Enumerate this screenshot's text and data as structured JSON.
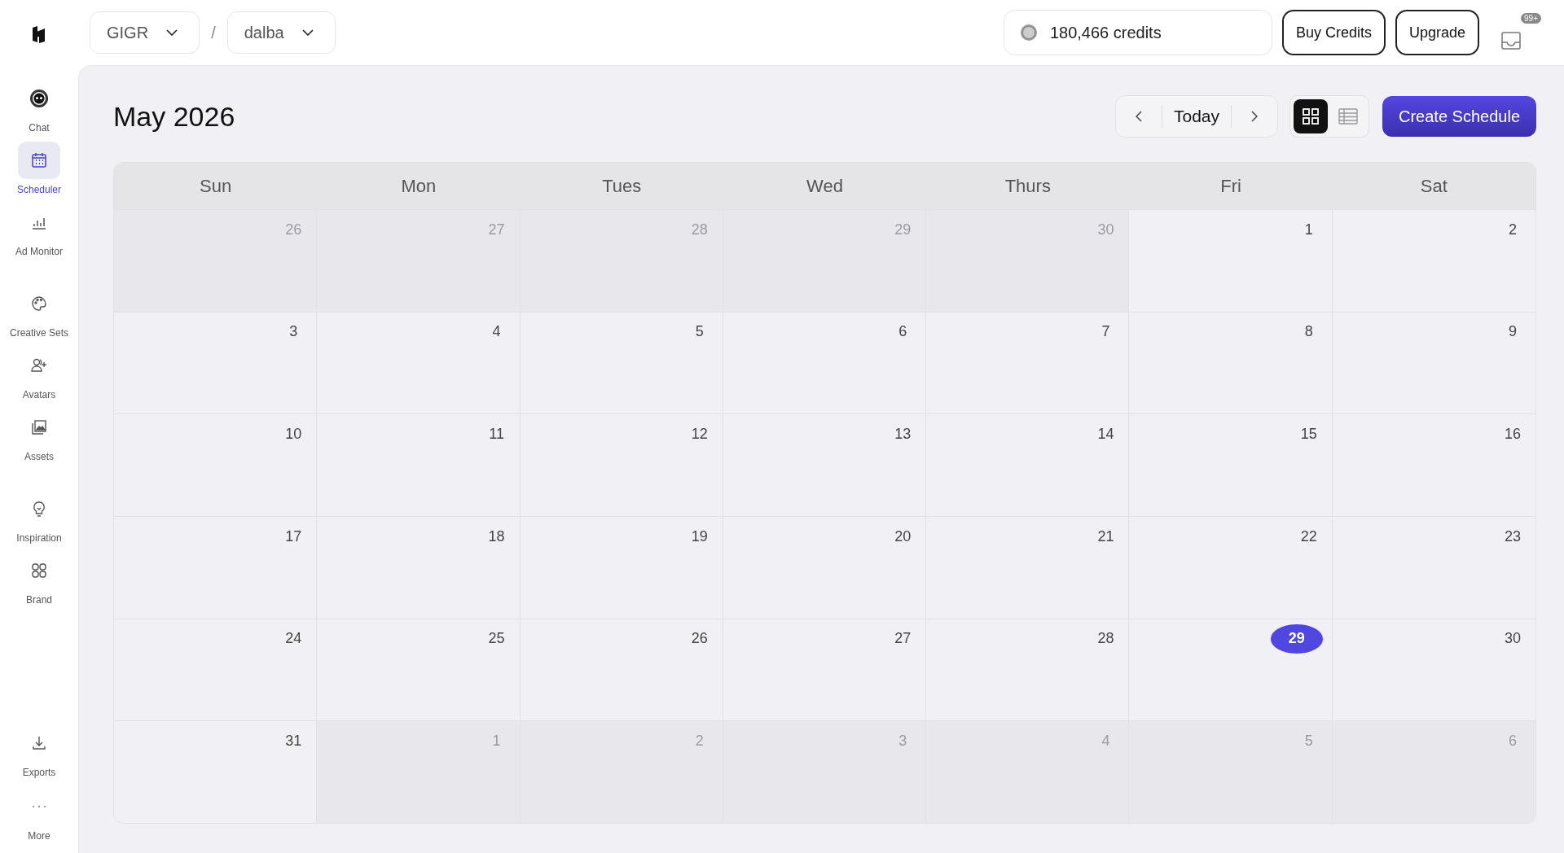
{
  "topbar": {
    "workspace": {
      "label": "GIGR"
    },
    "separator": "/",
    "project": {
      "label": "dalba"
    },
    "credits": "180,466 credits",
    "buttons": [
      "Buy Credits",
      "Upgrade"
    ],
    "notifications": {
      "badge": "99+"
    }
  },
  "sidebar": {
    "groups": [
      [
        {
          "label": "Chat",
          "selected": false
        },
        {
          "label": "Scheduler",
          "selected": true
        },
        {
          "label": "Ad Monitor",
          "selected": false
        }
      ],
      [
        {
          "label": "Creative Sets",
          "selected": false
        },
        {
          "label": "Avatars",
          "selected": false
        },
        {
          "label": "Assets",
          "selected": false
        }
      ],
      [
        {
          "label": "Inspiration",
          "selected": false
        },
        {
          "label": "Brand",
          "selected": false
        }
      ]
    ],
    "bottom": [
      {
        "label": "Exports",
        "selected": false
      },
      {
        "label": "More",
        "selected": false
      }
    ]
  },
  "calendar": {
    "title": "May 2026",
    "today_button": "Today",
    "views": [
      {
        "kind": "grid",
        "selected": true
      },
      {
        "kind": "list",
        "selected": false
      }
    ],
    "create_button": "Create Schedule",
    "weekdays": [
      "Sun",
      "Mon",
      "Tues",
      "Wed",
      "Thurs",
      "Fri",
      "Sat"
    ],
    "weeks": [
      [
        {
          "day": "26",
          "outside": true,
          "today": false
        },
        {
          "day": "27",
          "outside": true,
          "today": false
        },
        {
          "day": "28",
          "outside": true,
          "today": false
        },
        {
          "day": "29",
          "outside": true,
          "today": false
        },
        {
          "day": "30",
          "outside": true,
          "today": false
        },
        {
          "day": "1",
          "outside": false,
          "today": false
        },
        {
          "day": "2",
          "outside": false,
          "today": false
        }
      ],
      [
        {
          "day": "3",
          "outside": false,
          "today": false
        },
        {
          "day": "4",
          "outside": false,
          "today": false
        },
        {
          "day": "5",
          "outside": false,
          "today": false
        },
        {
          "day": "6",
          "outside": false,
          "today": false
        },
        {
          "day": "7",
          "outside": false,
          "today": false
        },
        {
          "day": "8",
          "outside": false,
          "today": false
        },
        {
          "day": "9",
          "outside": false,
          "today": false
        }
      ],
      [
        {
          "day": "10",
          "outside": false,
          "today": false
        },
        {
          "day": "11",
          "outside": false,
          "today": false
        },
        {
          "day": "12",
          "outside": false,
          "today": false
        },
        {
          "day": "13",
          "outside": false,
          "today": false
        },
        {
          "day": "14",
          "outside": false,
          "today": false
        },
        {
          "day": "15",
          "outside": false,
          "today": false
        },
        {
          "day": "16",
          "outside": false,
          "today": false
        }
      ],
      [
        {
          "day": "17",
          "outside": false,
          "today": false
        },
        {
          "day": "18",
          "outside": false,
          "today": false
        },
        {
          "day": "19",
          "outside": false,
          "today": false
        },
        {
          "day": "20",
          "outside": false,
          "today": false
        },
        {
          "day": "21",
          "outside": false,
          "today": false
        },
        {
          "day": "22",
          "outside": false,
          "today": false
        },
        {
          "day": "23",
          "outside": false,
          "today": false
        }
      ],
      [
        {
          "day": "24",
          "outside": false,
          "today": false
        },
        {
          "day": "25",
          "outside": false,
          "today": false
        },
        {
          "day": "26",
          "outside": false,
          "today": false
        },
        {
          "day": "27",
          "outside": false,
          "today": false
        },
        {
          "day": "28",
          "outside": false,
          "today": false
        },
        {
          "day": "29",
          "outside": false,
          "today": true
        },
        {
          "day": "30",
          "outside": false,
          "today": false
        }
      ],
      [
        {
          "day": "31",
          "outside": false,
          "today": false
        },
        {
          "day": "1",
          "outside": true,
          "today": false
        },
        {
          "day": "2",
          "outside": true,
          "today": false
        },
        {
          "day": "3",
          "outside": true,
          "today": false
        },
        {
          "day": "4",
          "outside": true,
          "today": false
        },
        {
          "day": "5",
          "outside": true,
          "today": false
        },
        {
          "day": "6",
          "outside": true,
          "today": false
        }
      ]
    ]
  }
}
